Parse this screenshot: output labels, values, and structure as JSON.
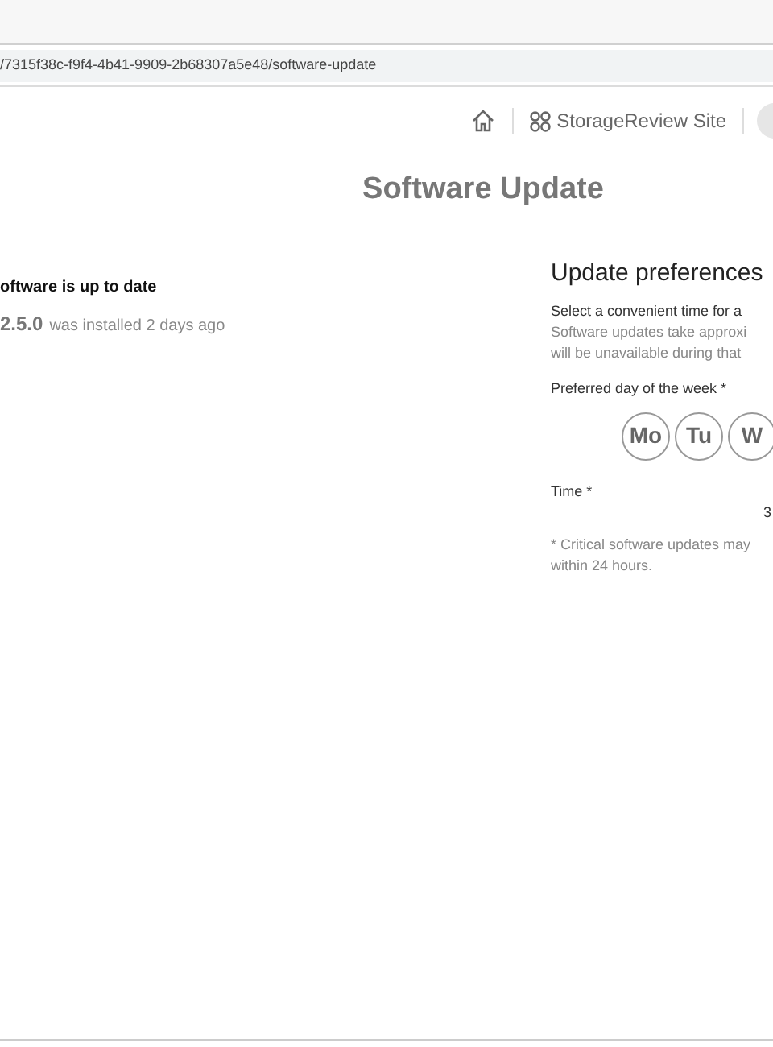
{
  "browser": {
    "url": "/7315f38c-f9f4-4b41-9909-2b68307a5e48/software-update"
  },
  "header": {
    "site": "StorageReview Site"
  },
  "title": "Software Update",
  "status": {
    "heading": "oftware is up to date",
    "version": "2.5.0",
    "installed": "was installed 2 days ago"
  },
  "preferences": {
    "heading": "Update preferences",
    "intro": "Select a convenient time for a",
    "note_lines": [
      "Software updates take approxi",
      "will be unavailable during that"
    ],
    "day_label": "Preferred day of the week *",
    "days": [
      {
        "label": "Mo",
        "selected": false
      },
      {
        "label": "Tu",
        "selected": false
      },
      {
        "label": "W",
        "selected": false
      }
    ],
    "time_label": "Time *",
    "time_value": "3",
    "footnote_lines": [
      "* Critical software updates may",
      "within 24 hours."
    ]
  }
}
